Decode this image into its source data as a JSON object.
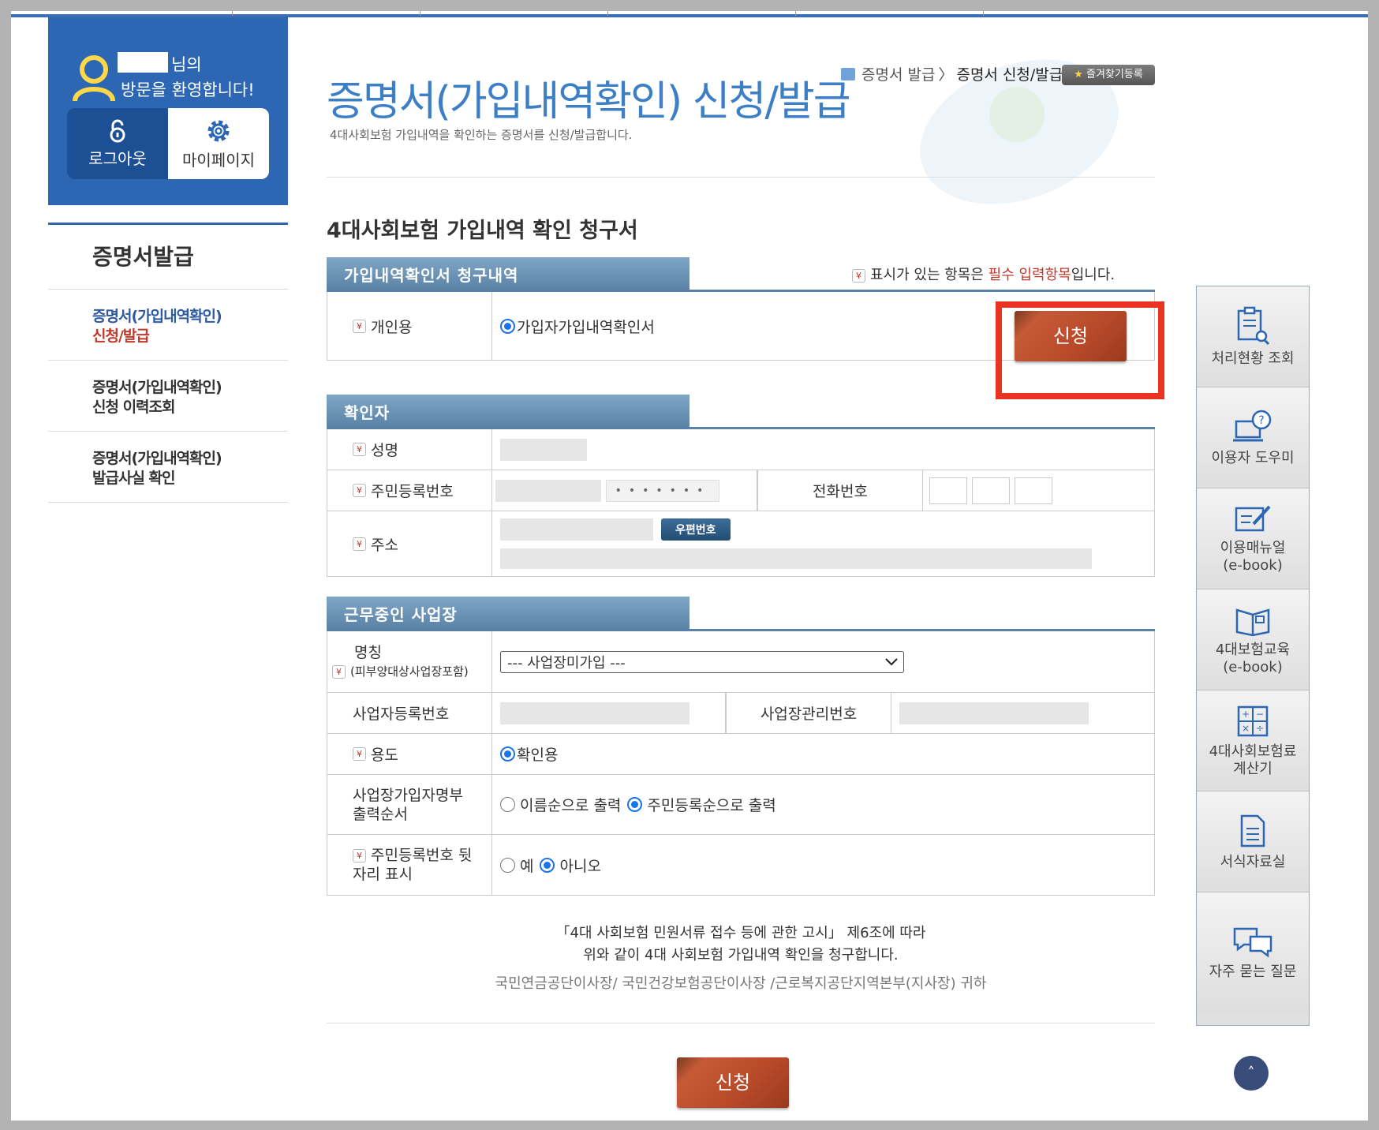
{
  "user": {
    "greeting_suffix": "님의",
    "greeting_line2": "방문을 환영합니다!",
    "logout_label": "로그아웃",
    "mypage_label": "마이페이지"
  },
  "nav": {
    "title": "증명서발급",
    "items": [
      {
        "line1": "증명서(가입내역확인)",
        "line2": "신청/발급"
      },
      {
        "line1": "증명서(가입내역확인)",
        "line2": "신청 이력조회"
      },
      {
        "line1": "증명서(가입내역확인)",
        "line2": "발급사실 확인"
      }
    ]
  },
  "header": {
    "breadcrumb_home": "증명서 발급",
    "breadcrumb_sep": "〉",
    "breadcrumb_current": "증명서 신청/발급",
    "favorite_label": "즐겨찾기등록",
    "title": "증명서(가입내역확인) 신청/발급",
    "subtitle": "4대사회보험 가입내역을 확인하는 증명서를 신청/발급합니다."
  },
  "form": {
    "title": "4대사회보험 가입내역 확인 청구서",
    "required_note_pre": "표시가 있는 항목은 ",
    "required_note_red": "필수 입력항목",
    "required_note_post": "입니다.",
    "required_icon": "¥"
  },
  "section1": {
    "tab": "가입내역확인서 청구내역",
    "row_label": "개인용",
    "option": "가입자가입내역확인서",
    "apply_label": "신청"
  },
  "section2": {
    "tab": "확인자",
    "name_label": "성명",
    "rrn_label": "주민등록번호",
    "rrn_masked": "•••••••",
    "phone_label": "전화번호",
    "address_label": "주소",
    "zip_button": "우편번호"
  },
  "section3": {
    "tab": "근무중인 사업장",
    "company_label": "명칭",
    "company_sub": "(피부양대상사업장포함)",
    "company_select": "--- 사업장미가입 ---",
    "bizno_label": "사업자등록번호",
    "mgmtno_label": "사업장관리번호",
    "purpose_label": "용도",
    "purpose_option": "확인용",
    "order_label_l1": "사업장가입자명부",
    "order_label_l2": "출력순서",
    "order_opt1": "이름순으로 출력",
    "order_opt2": "주민등록순으로 출력",
    "rrn_tail_label_l1": "주민등록번호 뒷",
    "rrn_tail_label_l2": "자리 표시",
    "rrn_tail_yes": "예",
    "rrn_tail_no": "아니오"
  },
  "declaration": {
    "line1": "「4대 사회보험 민원서류 접수 등에 관한 고시」  제6조에 따라",
    "line2": "위와 같이 4대 사회보험 가입내역 확인을 청구합니다.",
    "line3": "국민연금공단이사장/ 국민건강보험공단이사장 /근로복지공단지역본부(지사장) 귀하"
  },
  "bottom_apply_label": "신청",
  "quick_menu": [
    {
      "label": "처리현황 조회",
      "icon": "clipboard-search-icon"
    },
    {
      "label": "이용자 도우미",
      "icon": "monitor-help-icon"
    },
    {
      "label": "이용매뉴얼\n(e-book)",
      "icon": "pencil-edit-icon"
    },
    {
      "label": "4대보험교육\n(e-book)",
      "icon": "open-book-icon"
    },
    {
      "label": "4대사회보험료\n계산기",
      "icon": "calculator-icon"
    },
    {
      "label": "서식자료실",
      "icon": "document-icon"
    },
    {
      "label": "자주 묻는 질문",
      "icon": "chat-bubbles-icon"
    }
  ],
  "top_button": "˄",
  "colors": {
    "brand_blue": "#2d67b3",
    "title_blue": "#3d7fc6",
    "section_tab": "#5a82a6",
    "apply_button": "#b84a2a",
    "highlight_red": "#ea3323",
    "required_red": "#c0392b"
  }
}
